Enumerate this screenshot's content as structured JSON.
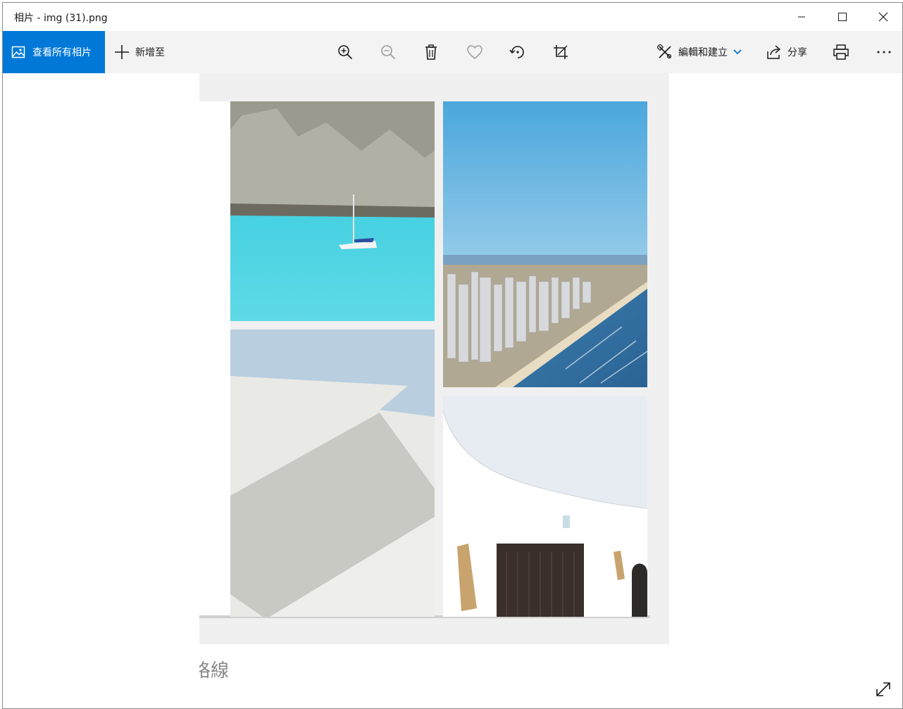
{
  "window": {
    "title": "相片 - img (31).png"
  },
  "toolbar": {
    "all_photos_label": "查看所有相片",
    "add_to_label": "新增至",
    "edit_create_label": "編輯和建立",
    "share_label": "分享"
  },
  "image": {
    "caption": "格線"
  },
  "colors": {
    "accent": "#0078d7",
    "toolbar_bg": "#f3f3f3"
  }
}
